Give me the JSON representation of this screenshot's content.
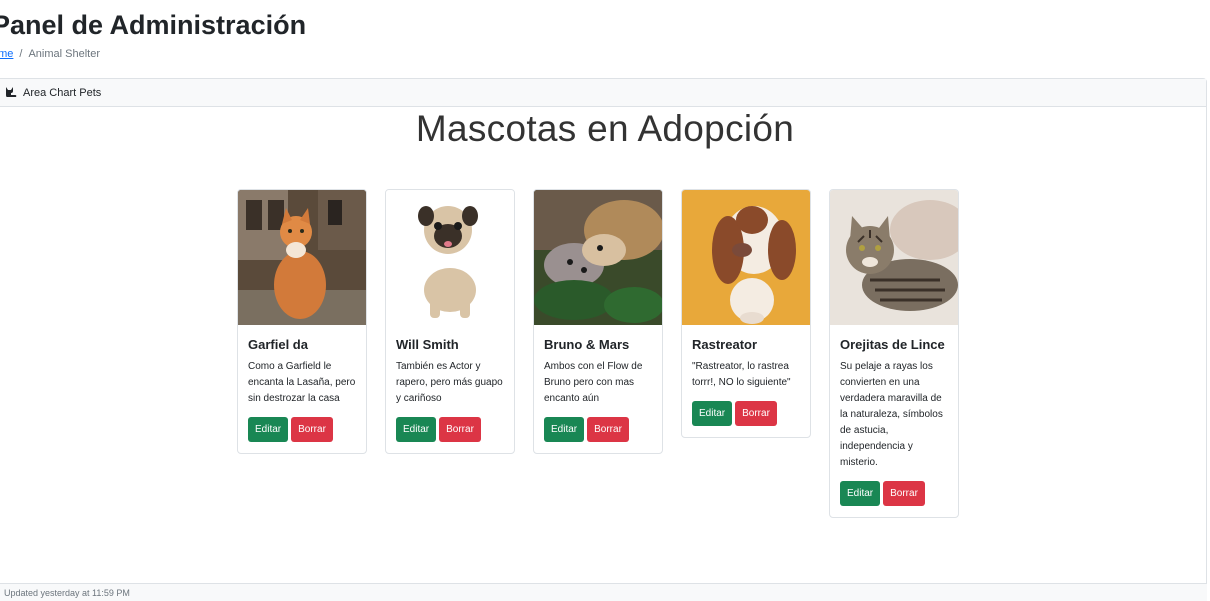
{
  "header": {
    "title": "Panel de Administración",
    "breadcrumb": {
      "home": "ome",
      "separator": "/",
      "current": "Animal Shelter"
    }
  },
  "card": {
    "header_icon": "cat-icon",
    "header_label": "Area Chart Pets",
    "heading": "Mascotas en Adopción"
  },
  "pets": [
    {
      "name": "Garfiel da",
      "description": "Como a Garfield le encanta la Lasaña, pero sin destrozar la casa",
      "edit": "Editar",
      "delete": "Borrar"
    },
    {
      "name": "Will Smith",
      "description": "También es Actor y rapero, pero más guapo y cariñoso",
      "edit": "Editar",
      "delete": "Borrar"
    },
    {
      "name": "Bruno & Mars",
      "description": "Ambos con el Flow de Bruno pero con mas encanto aún",
      "edit": "Editar",
      "delete": "Borrar"
    },
    {
      "name": "Rastreator",
      "description": "\"Rastreator, lo rastrea torrr!, NO lo siguiente\"",
      "edit": "Editar",
      "delete": "Borrar"
    },
    {
      "name": "Orejitas de Lince",
      "description": "Su pelaje a rayas los convierten en una verdadera maravilla de la naturaleza, símbolos de astucia, independencia y misterio.",
      "edit": "Editar",
      "delete": "Borrar"
    }
  ],
  "footer": {
    "text": "Updated yesterday at 11:59 PM"
  },
  "colors": {
    "edit": "#198754",
    "delete": "#dc3545",
    "link": "#0d6efd"
  }
}
